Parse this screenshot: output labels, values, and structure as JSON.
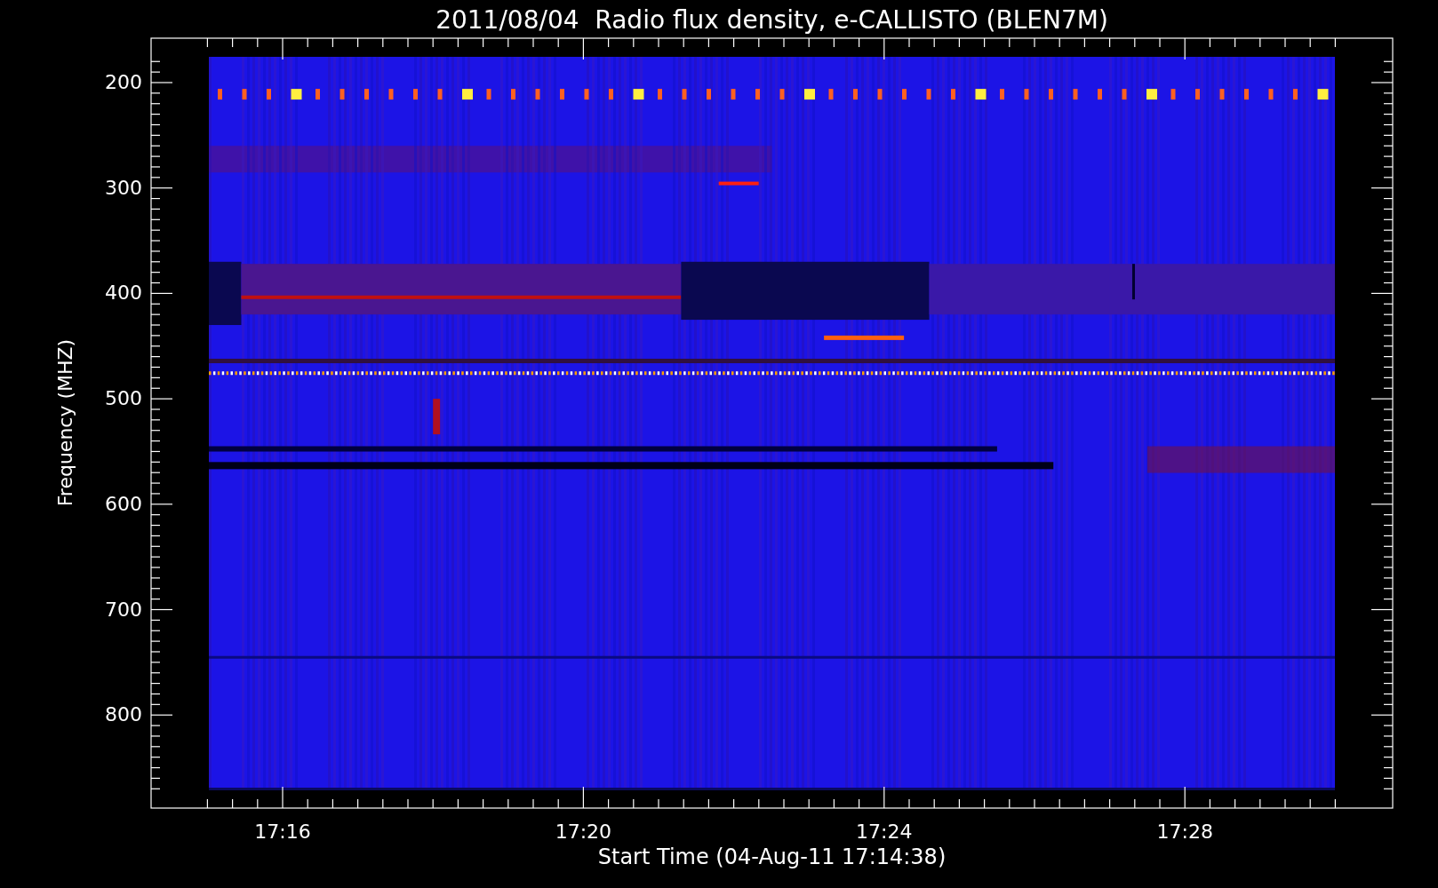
{
  "title": "2011/08/04  Radio flux density, e-CALLISTO (BLEN7M)",
  "ylabel": "Frequency (MHZ)",
  "xlabel": "Start Time (04-Aug-11 17:14:38)",
  "yticks": [
    "200",
    "300",
    "400",
    "500",
    "600",
    "700",
    "800"
  ],
  "xticks": [
    "17:16",
    "17:20",
    "17:24",
    "17:28"
  ]
}
